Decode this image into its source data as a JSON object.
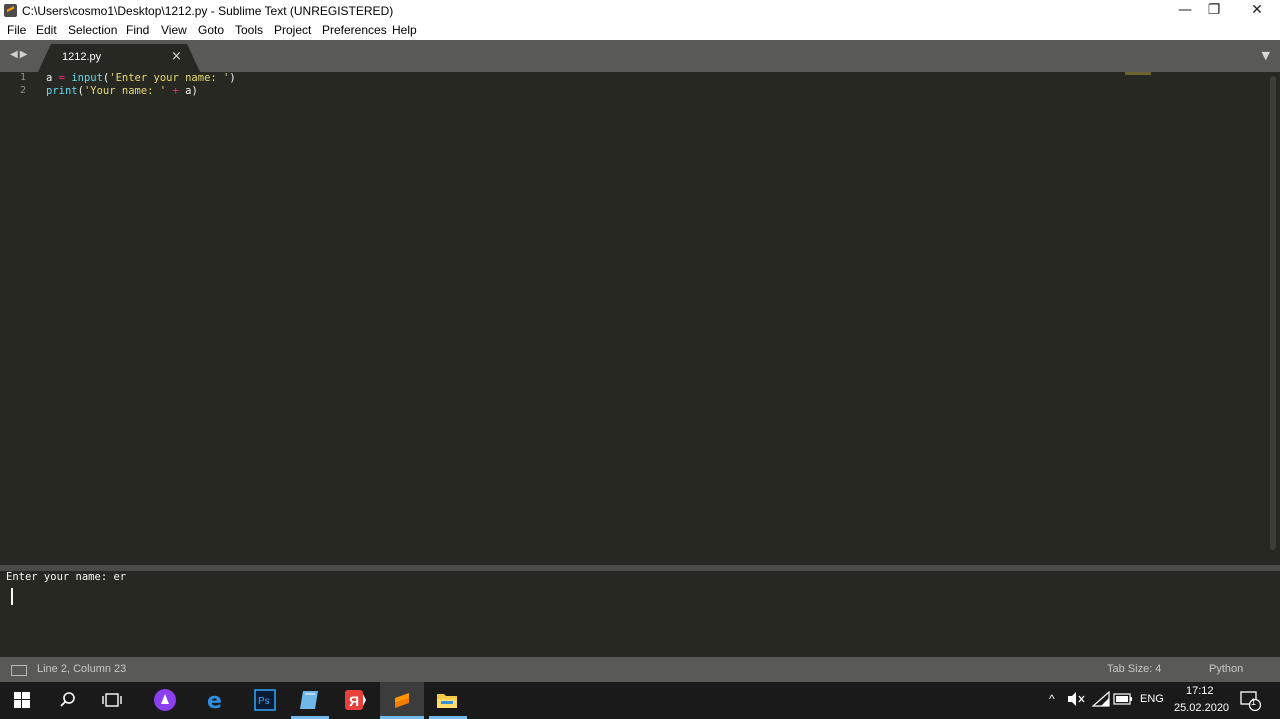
{
  "window": {
    "title": "C:\\Users\\cosmo1\\Desktop\\1212.py - Sublime Text (UNREGISTERED)",
    "minimize": "—",
    "restore": "❐",
    "close": "✕"
  },
  "menu": [
    "File",
    "Edit",
    "Selection",
    "Find",
    "View",
    "Goto",
    "Tools",
    "Project",
    "Preferences",
    "Help"
  ],
  "tabs": {
    "nav": "◀▶",
    "active": {
      "label": "1212.py",
      "close": "×"
    },
    "dropdown": "▼"
  },
  "editor": {
    "line_numbers": [
      "1",
      "2"
    ],
    "line1": {
      "var": "a",
      "eq": "=",
      "fn": "input",
      "open": "(",
      "str": "'Enter your name: '",
      "close": ")"
    },
    "line2": {
      "fn": "print",
      "open": "(",
      "str": "'Your name: '",
      "plus": "+",
      "var": "a",
      "close": ")"
    }
  },
  "output": {
    "text": "Enter your name: er"
  },
  "status": {
    "position": "Line 2, Column 23",
    "tab_size": "Tab Size: 4",
    "syntax": "Python"
  },
  "taskbar": {
    "apps": [
      "start-icon",
      "search-icon",
      "task-view-icon",
      "alice-icon",
      "edge-icon",
      "photoshop-icon",
      "notes-icon",
      "yandex-browser-icon",
      "sublime-text-icon",
      "file-explorer-icon"
    ],
    "tray": {
      "lang": "ENG",
      "time": "17:12",
      "date": "25.02.2020",
      "notifications": "1"
    }
  },
  "colors": {
    "editor_bg": "#272822",
    "keyword": "#f92672",
    "function": "#66d9ef",
    "string": "#e6db74"
  }
}
